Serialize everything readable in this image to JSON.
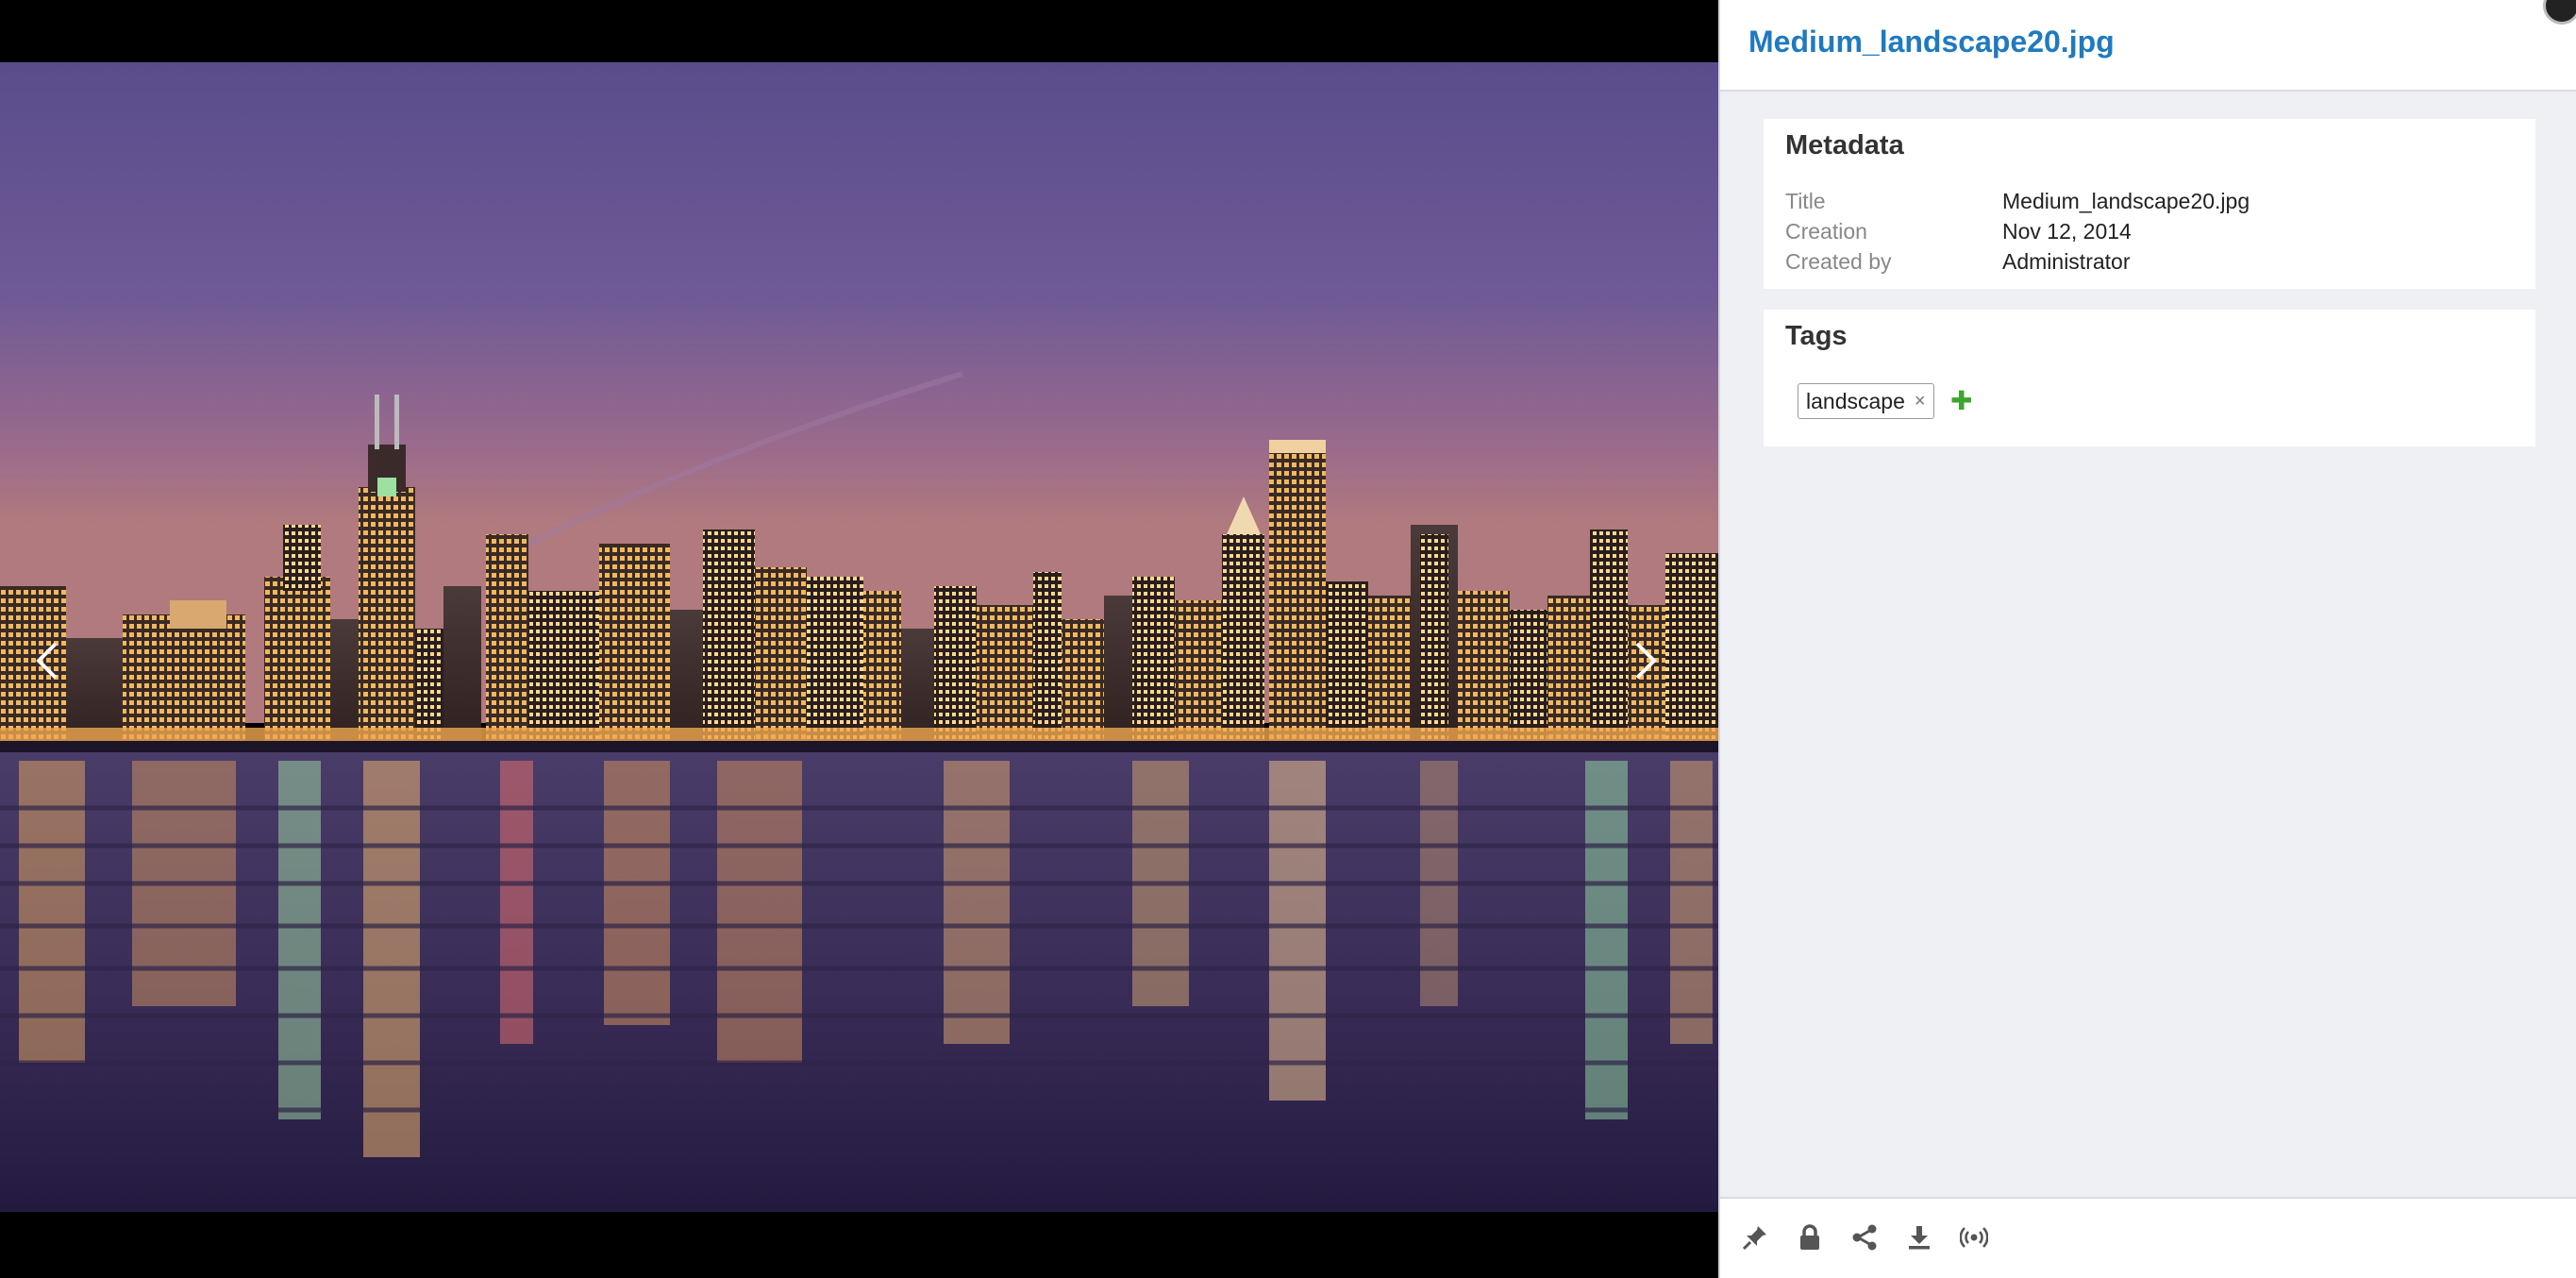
{
  "file": {
    "title": "Medium_landscape20.jpg"
  },
  "metadata": {
    "heading": "Metadata",
    "rows": [
      {
        "label": "Title",
        "value": "Medium_landscape20.jpg"
      },
      {
        "label": "Creation",
        "value": "Nov 12, 2014"
      },
      {
        "label": "Created by",
        "value": "Administrator"
      }
    ]
  },
  "tags": {
    "heading": "Tags",
    "items": [
      {
        "label": "landscape",
        "remove_glyph": "×"
      }
    ],
    "add_glyph": "✚"
  },
  "footer_tools": [
    {
      "icon": "pin-icon"
    },
    {
      "icon": "lock-icon"
    },
    {
      "icon": "share-icon"
    },
    {
      "icon": "download-icon"
    },
    {
      "icon": "broadcast-icon"
    }
  ],
  "colors": {
    "title_link": "#1f7ac0",
    "tag_add": "#3aa62f",
    "panel_bg": "#eef0f4"
  }
}
